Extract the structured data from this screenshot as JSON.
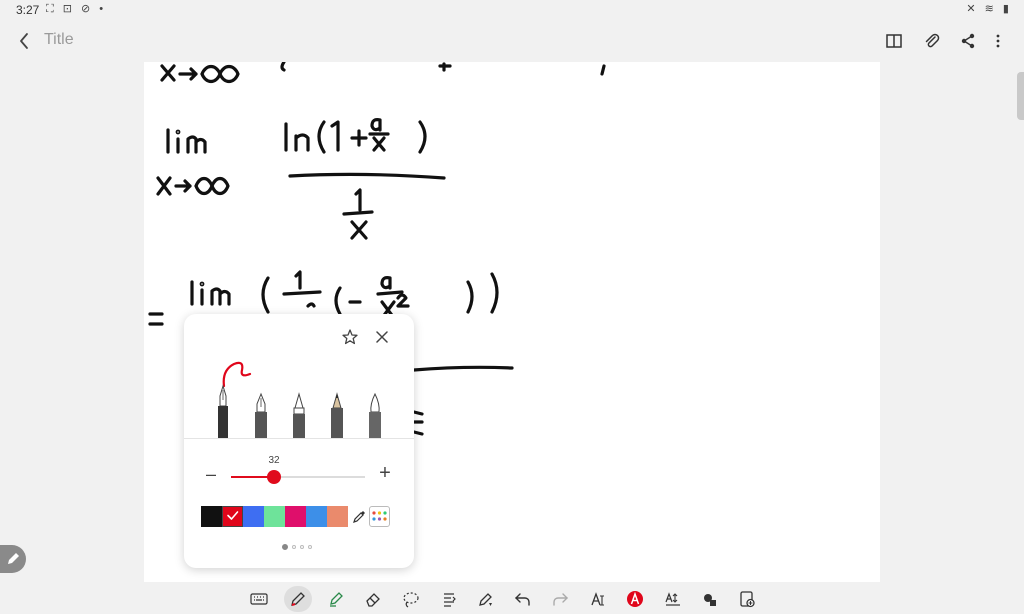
{
  "status_bar": {
    "time": "3:27",
    "left_icons": "⛶ ⊡ ⊘ •",
    "right_icons": "✕ ≋ ▮"
  },
  "app_bar": {
    "title_placeholder": "Title",
    "back_icon": "chevron-left-icon",
    "actions": [
      "book-icon",
      "attach-icon",
      "share-icon",
      "more-vertical-icon"
    ]
  },
  "pen_popup": {
    "size_value": 32,
    "size_min": 0,
    "size_max": 100,
    "size_minus_label": "–",
    "size_plus_label": "+",
    "pens": [
      "fountain-pen",
      "calligraphy-pen",
      "pen",
      "pencil",
      "brush"
    ],
    "selected_pen": 0,
    "colors": [
      "#111111",
      "#e0061b",
      "#3e6ef2",
      "#6ee39a",
      "#df0f6b",
      "#3d8fe8",
      "#ea8a6c"
    ],
    "selected_color": 1,
    "page_count": 4,
    "current_page": 0
  },
  "toolbar": {
    "tools": [
      "keyboard-icon",
      "pen-icon",
      "highlighter-icon",
      "eraser-icon",
      "lasso-icon",
      "text-align-icon",
      "shape-pen-icon",
      "undo-icon",
      "redo-icon",
      "text-tool-icon",
      "text-color-icon",
      "text-format-icon",
      "shapes-icon",
      "insert-icon"
    ],
    "active_tool": 1
  },
  "accent_color": "#e00b1c"
}
